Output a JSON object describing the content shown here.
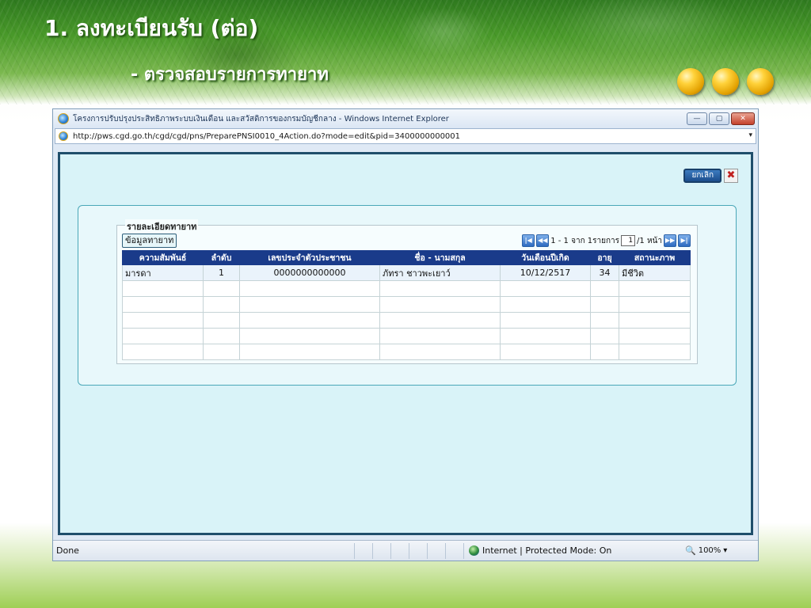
{
  "slide": {
    "title": "1. ลงทะเบียนรับ (ต่อ)",
    "subtitle": "- ตรวจสอบรายการทายาท"
  },
  "browser": {
    "window_title": "โครงการปรับปรุงประสิทธิภาพระบบเงินเดือน และสวัสดิการของกรมบัญชีกลาง - Windows Internet Explorer",
    "url": "http://pws.cgd.go.th/cgd/cgd/pns/PreparePNSI0010_4Action.do?mode=edit&pid=3400000000001",
    "minimize": "—",
    "maximize": "▢",
    "close": "✕",
    "dropdown": "▾"
  },
  "page": {
    "cancel_label": "ยกเลิก",
    "cancel_icon": "✖",
    "fieldset_legend": "รายละเอียดทายาท",
    "tab_label": "ข้อมูลทายาท",
    "pager": {
      "first": "|◀",
      "prev": "◀◀",
      "summary": "1 - 1 จาก 1รายการ",
      "page_value": "1",
      "page_total": "/1 หน้า",
      "next": "▶▶",
      "last": "▶|"
    },
    "table": {
      "headers": [
        "ความสัมพันธ์",
        "ลำดับ",
        "เลขประจำตัวประชาชน",
        "ชื่อ - นามสกุล",
        "วันเดือนปีเกิด",
        "อายุ",
        "สถานะภาพ"
      ],
      "rows": [
        [
          "มารดา",
          "1",
          "0000000000000",
          "ภัทรา ชาวพะเยาว์",
          "10/12/2517",
          "34",
          "มีชีวิต"
        ]
      ]
    }
  },
  "statusbar": {
    "done": "Done",
    "zone": "Internet | Protected Mode: On",
    "zoom": "100%",
    "zoom_arrow": "▾"
  },
  "icons": {
    "ie": "ie-icon",
    "globe": "globe-icon",
    "zoom": "🔍"
  }
}
